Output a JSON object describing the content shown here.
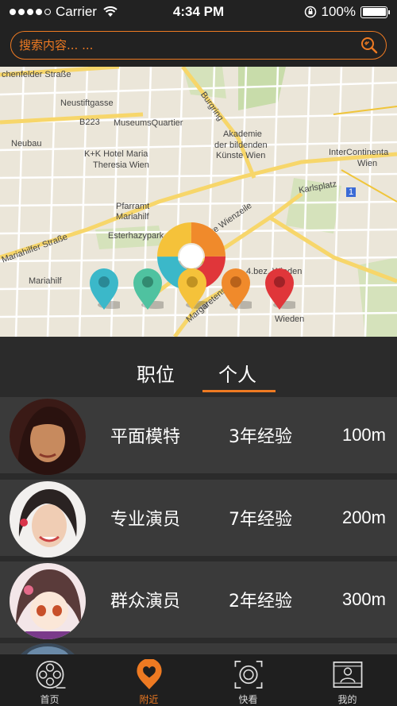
{
  "status_bar": {
    "carrier": "Carrier",
    "time": "4:34 PM",
    "battery": "100%",
    "battery_level": 1.0
  },
  "search": {
    "placeholder": "搜索内容... ...",
    "accent_color": "#ee7a22",
    "icon": "search-icon"
  },
  "map": {
    "labels": {
      "l1": "chenfelder Straße",
      "l2": "Neustiftgasse",
      "l3": "B223",
      "l4": "MuseumsQuartier",
      "l5": "Neubau",
      "l6": "K+K Hotel Maria",
      "l7": "Theresia Wien",
      "l8": "Pfarramt",
      "l9": "Mariahilf",
      "l10": "Esterhazypark",
      "l11": "Mariahilf",
      "l12": "Akademie",
      "l13": "der bildenden",
      "l14": "Künste Wien",
      "l15": "Burgring",
      "l16": "InterContinenta",
      "l17": "Wien",
      "l18": "Karlsplatz",
      "l19": "Linke Wienzeile",
      "l20": "4.bez. Wieden",
      "l21": "Wieden",
      "l22": "Mariahilfer Straße",
      "l23": "Margaretenstraße",
      "l24": "1"
    },
    "pin_colors": [
      "#3bb8c9",
      "#4fc2a0",
      "#f5c23a",
      "#f08a2b",
      "#e0363a"
    ],
    "donut_colors": [
      "#3bb8c9",
      "#4fc2a0",
      "#f5c23a",
      "#f08a2b",
      "#e0363a"
    ]
  },
  "tabs": {
    "job": "职位",
    "person": "个人",
    "active": "person"
  },
  "list": [
    {
      "role": "平面模特",
      "experience": "3年经验",
      "distance": "100m"
    },
    {
      "role": "专业演员",
      "experience": "7年经验",
      "distance": "200m"
    },
    {
      "role": "群众演员",
      "experience": "2年经验",
      "distance": "300m"
    }
  ],
  "nav": {
    "home": "首页",
    "nearby": "附近",
    "quick_view": "快看",
    "mine": "我的",
    "active": "nearby"
  }
}
